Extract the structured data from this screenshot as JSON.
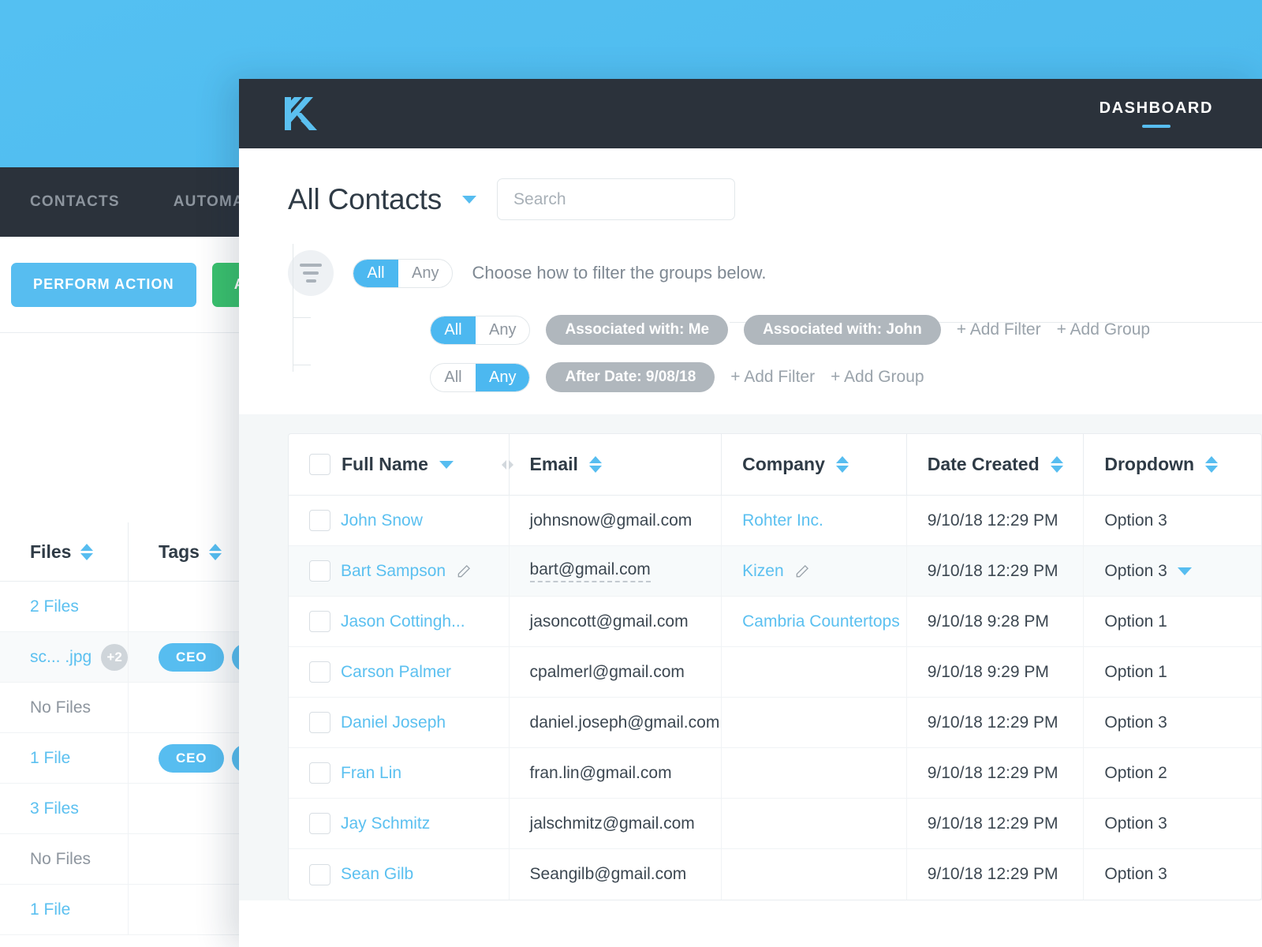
{
  "background": {
    "nav_items": [
      {
        "label": "CONTACTS"
      },
      {
        "label": "AUTOMATIONS"
      }
    ],
    "buttons": [
      {
        "label": "PERFORM ACTION",
        "color": "#57bdf0"
      },
      {
        "label": "ADD",
        "color": "#3ac16e"
      }
    ],
    "table": {
      "columns": [
        {
          "label": "Files",
          "sort": "none"
        },
        {
          "label": "Tags",
          "sort": "none"
        }
      ],
      "rows": [
        {
          "files": "2 Files",
          "files_muted": false,
          "extra": "",
          "tags": []
        },
        {
          "files": "sc... .jpg",
          "files_muted": false,
          "extra": "+2",
          "tags": [
            "CEO",
            ""
          ]
        },
        {
          "files": "No Files",
          "files_muted": true,
          "extra": "",
          "tags": []
        },
        {
          "files": "1 File",
          "files_muted": false,
          "extra": "",
          "tags": [
            "CEO",
            ""
          ]
        },
        {
          "files": "3 Files",
          "files_muted": false,
          "extra": "",
          "tags": []
        },
        {
          "files": "No Files",
          "files_muted": true,
          "extra": "",
          "tags": []
        },
        {
          "files": "1 File",
          "files_muted": false,
          "extra": "",
          "tags": []
        }
      ]
    }
  },
  "header": {
    "logo_icon": "kizen-k-logo-icon",
    "nav_label": "DASHBOARD"
  },
  "toolbar": {
    "title": "All Contacts",
    "title_caret_icon": "chevron-down-icon",
    "search_placeholder": "Search",
    "search_value": ""
  },
  "filters": {
    "icon": "filter-icon",
    "root": {
      "all_label": "All",
      "any_label": "Any",
      "selected": "All"
    },
    "hint": "Choose how to filter the groups below.",
    "groups": [
      {
        "all_label": "All",
        "any_label": "Any",
        "selected": "All",
        "chips": [
          "Associated with: Me",
          "Associated with: John"
        ],
        "add_filter": "+ Add Filter",
        "add_group": "+ Add Group"
      },
      {
        "all_label": "All",
        "any_label": "Any",
        "selected": "Any",
        "chips": [
          "After Date: 9/08/18"
        ],
        "add_filter": "+ Add Filter",
        "add_group": "+ Add Group"
      }
    ]
  },
  "table": {
    "columns": [
      {
        "label": "Full Name",
        "sort": "desc"
      },
      {
        "label": "Email",
        "sort": "none"
      },
      {
        "label": "Company",
        "sort": "none"
      },
      {
        "label": "Date Created",
        "sort": "none"
      },
      {
        "label": "Dropdown",
        "sort": "none"
      }
    ],
    "rows": [
      {
        "name": "John Snow",
        "name_edit": false,
        "email": "johnsnow@gmail.com",
        "email_editing": false,
        "company": "Rohter Inc.",
        "company_edit": false,
        "date": "9/10/18 12:29 PM",
        "dropdown": "Option 3",
        "dropdown_open": false,
        "highlight": false
      },
      {
        "name": "Bart Sampson",
        "name_edit": true,
        "email": "bart@gmail.com",
        "email_editing": true,
        "company": "Kizen",
        "company_edit": true,
        "date": "9/10/18 12:29 PM",
        "dropdown": "Option 3",
        "dropdown_open": true,
        "highlight": true
      },
      {
        "name": "Jason Cottingh...",
        "name_edit": false,
        "email": "jasoncott@gmail.com",
        "email_editing": false,
        "company": "Cambria Countertops",
        "company_edit": false,
        "date": "9/10/18 9:28 PM",
        "dropdown": "Option 1",
        "dropdown_open": false,
        "highlight": false
      },
      {
        "name": "Carson Palmer",
        "name_edit": false,
        "email": "cpalmerl@gmail.com",
        "email_editing": false,
        "company": "",
        "company_edit": false,
        "date": "9/10/18 9:29 PM",
        "dropdown": "Option 1",
        "dropdown_open": false,
        "highlight": false
      },
      {
        "name": "Daniel Joseph",
        "name_edit": false,
        "email": "daniel.joseph@gmail.com",
        "email_editing": false,
        "company": "",
        "company_edit": false,
        "date": "9/10/18 12:29 PM",
        "dropdown": "Option 3",
        "dropdown_open": false,
        "highlight": false
      },
      {
        "name": "Fran Lin",
        "name_edit": false,
        "email": "fran.lin@gmail.com",
        "email_editing": false,
        "company": "",
        "company_edit": false,
        "date": "9/10/18 12:29 PM",
        "dropdown": "Option 2",
        "dropdown_open": false,
        "highlight": false
      },
      {
        "name": "Jay Schmitz",
        "name_edit": false,
        "email": "jalschmitz@gmail.com",
        "email_editing": false,
        "company": "",
        "company_edit": false,
        "date": "9/10/18 12:29 PM",
        "dropdown": "Option 3",
        "dropdown_open": false,
        "highlight": false
      },
      {
        "name": "Sean Gilb",
        "name_edit": false,
        "email": "Seangilb@gmail.com",
        "email_editing": false,
        "company": "",
        "company_edit": false,
        "date": "9/10/18 12:29 PM",
        "dropdown": "Option 3",
        "dropdown_open": false,
        "highlight": false
      }
    ]
  },
  "colors": {
    "accent_blue": "#57bdf0",
    "dark_navy": "#2b323b",
    "success_green": "#3ac16e",
    "chip_gray": "#b0b7bd",
    "page_bg_blue": "#4db9ec"
  }
}
